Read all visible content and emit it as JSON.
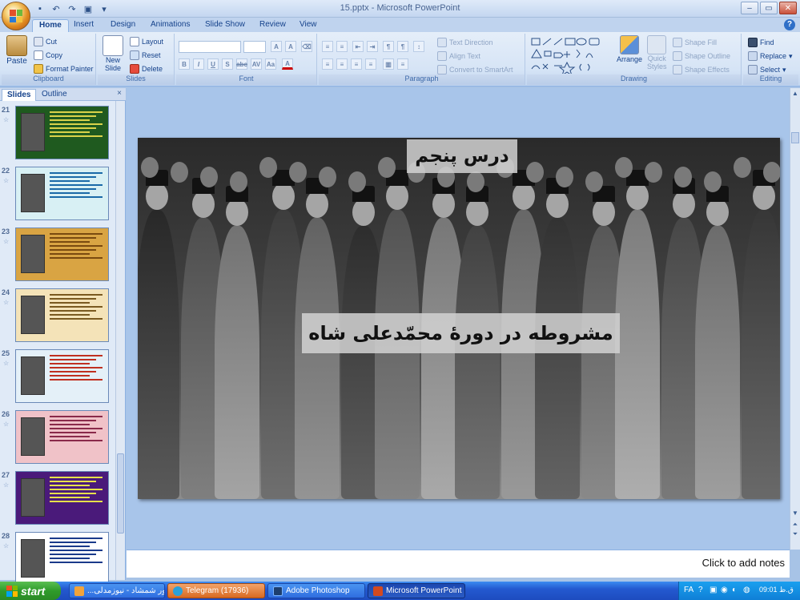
{
  "window": {
    "title": "15.pptx - Microsoft PowerPoint",
    "controls": [
      "–",
      "▭",
      "✕"
    ]
  },
  "ribbon_tabs": [
    "Home",
    "Insert",
    "Design",
    "Animations",
    "Slide Show",
    "Review",
    "View"
  ],
  "ribbon": {
    "clipboard": {
      "paste": "Paste",
      "cut": "Cut",
      "copy": "Copy",
      "format_painter": "Format Painter",
      "label": "Clipboard"
    },
    "slides": {
      "new_slide_1": "New",
      "new_slide_2": "Slide",
      "layout": "Layout",
      "reset": "Reset",
      "delete": "Delete",
      "label": "Slides"
    },
    "font": {
      "label": "Font",
      "format_buttons": [
        "B",
        "I",
        "U",
        "S",
        "abc",
        "AV",
        "Aa",
        "A"
      ]
    },
    "paragraph": {
      "text_direction": "Text Direction",
      "align_text": "Align Text",
      "convert_smartart": "Convert to SmartArt",
      "label": "Paragraph"
    },
    "drawing": {
      "arrange": "Arrange",
      "quick_styles_1": "Quick",
      "quick_styles_2": "Styles",
      "shape_fill": "Shape Fill",
      "shape_outline": "Shape Outline",
      "shape_effects": "Shape Effects",
      "label": "Drawing"
    },
    "editing": {
      "find": "Find",
      "replace": "Replace",
      "select": "Select",
      "label": "Editing"
    }
  },
  "left_panel": {
    "tabs": [
      "Slides",
      "Outline"
    ],
    "close": "×",
    "slides": [
      {
        "number": "21",
        "bg": "#1f5a1f",
        "accent": "#d9d24a"
      },
      {
        "number": "22",
        "bg": "#d8f0f4",
        "accent": "#1a6aa8"
      },
      {
        "number": "23",
        "bg": "#d9a443",
        "accent": "#7a4a10"
      },
      {
        "number": "24",
        "bg": "#f4e3b8",
        "accent": "#7a5a20"
      },
      {
        "number": "25",
        "bg": "#e4f0f8",
        "accent": "#c03020"
      },
      {
        "number": "26",
        "bg": "#f0c2c8",
        "accent": "#8a2a4a"
      },
      {
        "number": "27",
        "bg": "#4a1a7a",
        "accent": "#e6e04a"
      },
      {
        "number": "28",
        "bg": "#ffffff",
        "accent": "#1a3a8a"
      }
    ]
  },
  "slide": {
    "title": "درس پنجم",
    "subtitle": "مشروطه در دورۀ محمّدعلی شاه"
  },
  "notes_placeholder": "Click to add notes",
  "taskbar": {
    "start": "start",
    "tasks": [
      {
        "label": "...مهور شمشاد - نیوزمدلی",
        "style": "normal"
      },
      {
        "label": "Telegram (17936)",
        "style": "orange"
      },
      {
        "label": "Adobe Photoshop",
        "style": "normal"
      },
      {
        "label": "Microsoft PowerPoint ...",
        "style": "active"
      }
    ],
    "lang": "FA",
    "clock": "09:01 ق.ظ"
  }
}
